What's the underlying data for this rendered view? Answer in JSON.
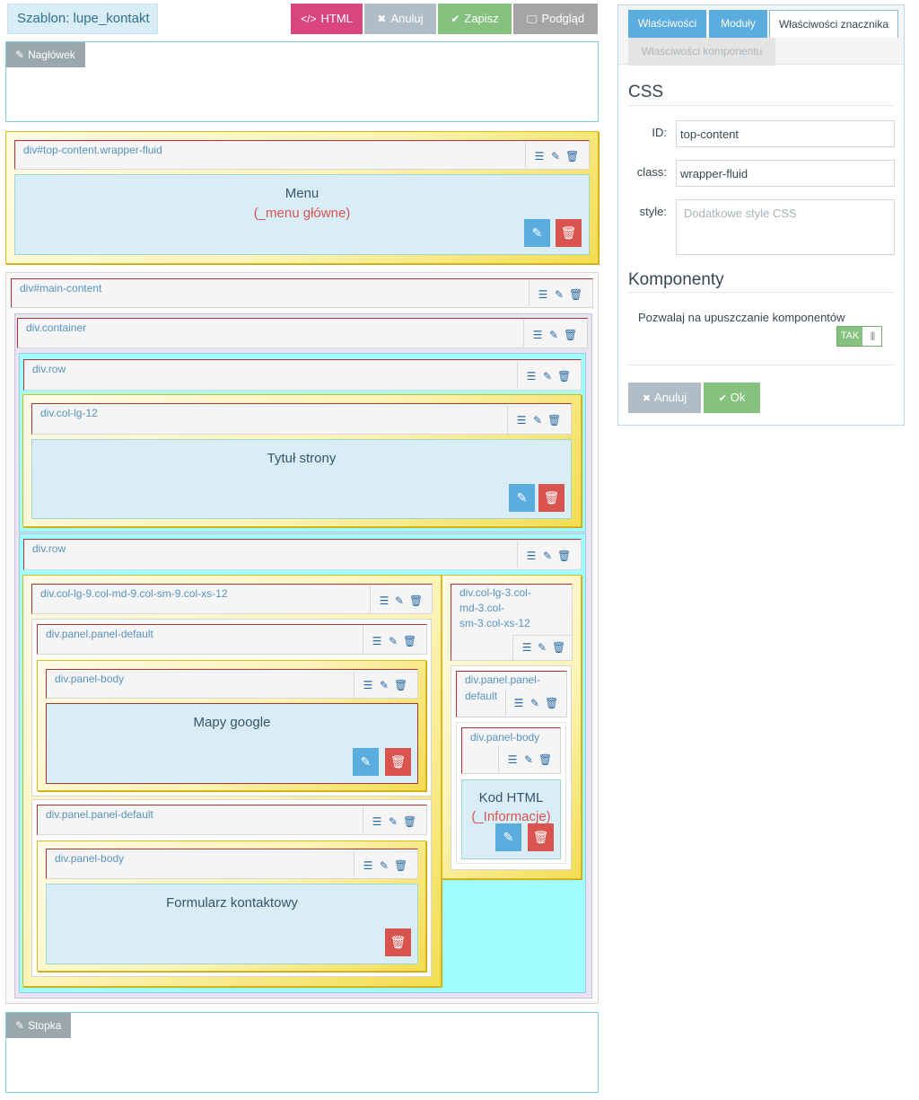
{
  "toolbar": {
    "template_label": "Szablon: lupe_kontakt",
    "html": "HTML",
    "cancel": "Anuluj",
    "save": "Zapisz",
    "preview": "Podgląd"
  },
  "header_zone": {
    "label": "Nagłówek"
  },
  "footer_zone": {
    "label": "Stopka"
  },
  "blocks": {
    "top_content": "div#top-content.wrapper-fluid",
    "main_content": "div#main-content",
    "container": "div.container",
    "row1": "div.row",
    "col_lg12": "div.col-lg-12",
    "row2": "div.row",
    "col9": "div.col-lg-9.col-md-9.col-sm-9.col-xs-12",
    "col3_l1": "div.col-lg-3.col-",
    "col3_l2": "md-3.col-",
    "col3_l3": "sm-3.col-xs-12",
    "panel1": "div.panel.panel-default",
    "panel1_body": "div.panel-body",
    "panel2": "div.panel.panel-default",
    "panel2_body": "div.panel-body",
    "panel3_l1": "div.panel.panel-",
    "panel3_l2": "default",
    "panel3_body": "div.panel-body"
  },
  "components": {
    "menu_title": "Menu",
    "menu_sub": "(_menu główne)",
    "page_title": "Tytuł strony",
    "maps": "Mapy google",
    "form": "Formularz kontaktowy",
    "code_title": "Kod HTML",
    "code_sub": "(_Informacje)"
  },
  "panel": {
    "tabs": [
      "Właściwości",
      "Moduły",
      "Właściwości znacznika",
      "Właściwości komponentu"
    ],
    "css_title": "CSS",
    "id_label": "ID:",
    "id_value": "top-content",
    "class_label": "class:",
    "class_value": "wrapper-fluid",
    "style_label": "style:",
    "style_placeholder": "Dodatkowe style CSS",
    "components_title": "Komponenty",
    "allow_drop_label": "Pozwalaj na upuszczanie komponentów",
    "toggle_on": "TAK",
    "cancel": "Anuluj",
    "ok": "Ok"
  },
  "icons": {
    "html": "code-icon",
    "cancel": "close-icon",
    "save": "check-icon",
    "preview": "monitor-icon",
    "edit": "pencil-icon",
    "move": "bars-icon",
    "props": "edit-icon",
    "delete": "trash-icon"
  },
  "colors": {
    "accent_pink": "#d9467d",
    "accent_green": "#86c17f",
    "accent_blue": "#5bacdf",
    "danger": "#d9534f",
    "cyan_bg": "#a2fdff"
  }
}
